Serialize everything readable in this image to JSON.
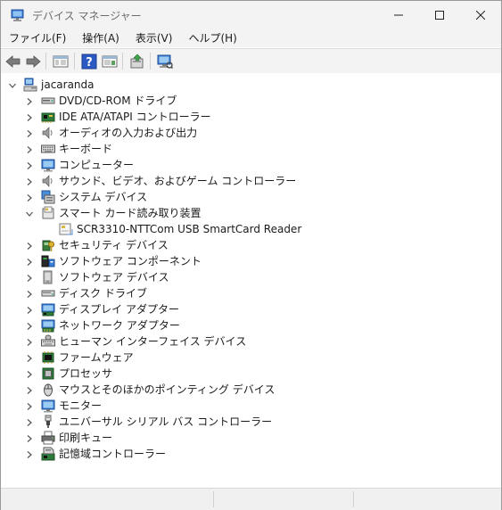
{
  "window": {
    "title": "デバイス マネージャー"
  },
  "menu": [
    "ファイル(F)",
    "操作(A)",
    "表示(V)",
    "ヘルプ(H)"
  ],
  "toolbar": {
    "buttons": [
      "back-icon",
      "forward-icon",
      "show-hide-console-tree-icon",
      "help-icon",
      "properties-icon",
      "update-driver-icon",
      "scan-hardware-icon"
    ]
  },
  "tree": {
    "root": "jacaranda",
    "items": [
      {
        "label": "DVD/CD-ROM ドライブ",
        "icon": "dvd-drive-icon",
        "expanded": false
      },
      {
        "label": "IDE ATA/ATAPI コントローラー",
        "icon": "ide-controller-icon",
        "expanded": false
      },
      {
        "label": "オーディオの入力および出力",
        "icon": "audio-icon",
        "expanded": false
      },
      {
        "label": "キーボード",
        "icon": "keyboard-icon",
        "expanded": false
      },
      {
        "label": "コンピューター",
        "icon": "computer-icon",
        "expanded": false
      },
      {
        "label": "サウンド、ビデオ、およびゲーム コントローラー",
        "icon": "sound-icon",
        "expanded": false
      },
      {
        "label": "システム デバイス",
        "icon": "system-devices-icon",
        "expanded": false
      },
      {
        "label": "スマート カード読み取り装置",
        "icon": "smart-card-reader-icon",
        "expanded": true,
        "children": [
          {
            "label": "SCR3310-NTTCom USB SmartCard Reader",
            "icon": "smart-card-device-icon"
          }
        ]
      },
      {
        "label": "セキュリティ デバイス",
        "icon": "security-device-icon",
        "expanded": false
      },
      {
        "label": "ソフトウェア コンポーネント",
        "icon": "software-component-icon",
        "expanded": false
      },
      {
        "label": "ソフトウェア デバイス",
        "icon": "software-device-icon",
        "expanded": false
      },
      {
        "label": "ディスク ドライブ",
        "icon": "disk-drive-icon",
        "expanded": false
      },
      {
        "label": "ディスプレイ アダプター",
        "icon": "display-adapter-icon",
        "expanded": false
      },
      {
        "label": "ネットワーク アダプター",
        "icon": "network-adapter-icon",
        "expanded": false
      },
      {
        "label": "ヒューマン インターフェイス デバイス",
        "icon": "hid-icon",
        "expanded": false
      },
      {
        "label": "ファームウェア",
        "icon": "firmware-icon",
        "expanded": false
      },
      {
        "label": "プロセッサ",
        "icon": "processor-icon",
        "expanded": false
      },
      {
        "label": "マウスとそのほかのポインティング デバイス",
        "icon": "mouse-icon",
        "expanded": false
      },
      {
        "label": "モニター",
        "icon": "monitor-icon",
        "expanded": false
      },
      {
        "label": "ユニバーサル シリアル バス コントローラー",
        "icon": "usb-icon",
        "expanded": false
      },
      {
        "label": "印刷キュー",
        "icon": "print-queue-icon",
        "expanded": false
      },
      {
        "label": "記憶域コントローラー",
        "icon": "storage-controller-icon",
        "expanded": false
      }
    ]
  },
  "colors": {
    "accent": "#2f6fd6",
    "chrome": "#f3f3f3"
  }
}
